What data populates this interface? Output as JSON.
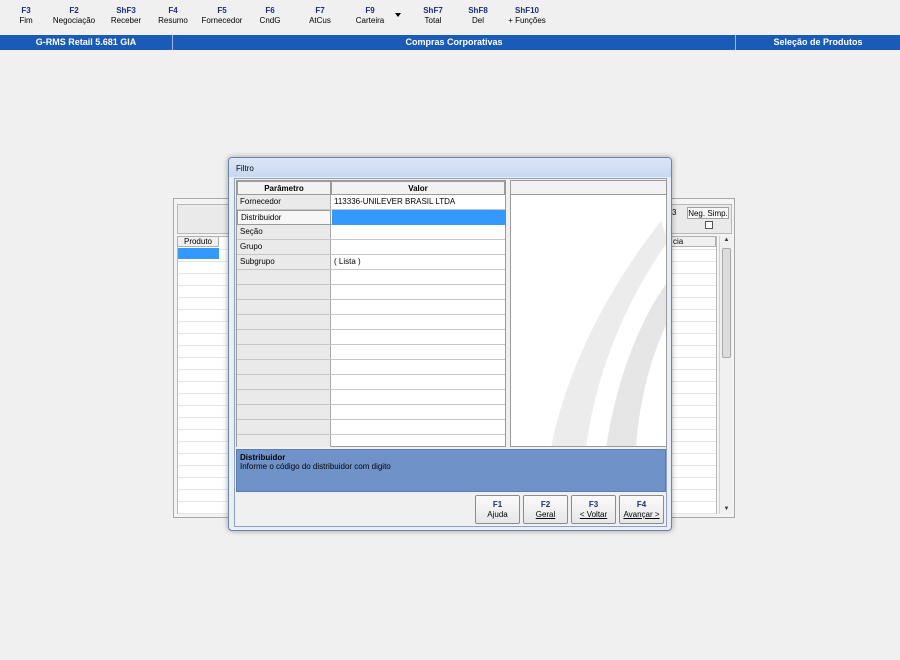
{
  "toolbar": {
    "keys": [
      {
        "key": "F3",
        "label": "Fim"
      },
      {
        "key": "F2",
        "label": "Negociação"
      },
      {
        "key": "ShF3",
        "label": "Receber"
      },
      {
        "key": "F4",
        "label": "Resumo"
      },
      {
        "key": "F5",
        "label": "Fornecedor"
      },
      {
        "key": "F6",
        "label": "CndG"
      },
      {
        "key": "F7",
        "label": "AtCus"
      },
      {
        "key": "F9",
        "label": "Carteira"
      },
      {
        "key": "ShF7",
        "label": "Total"
      },
      {
        "key": "ShF8",
        "label": "Del"
      },
      {
        "key": "ShF10",
        "label": "+ Funções"
      }
    ]
  },
  "titlebar": {
    "app": "G-RMS Retail 5.681 GIA",
    "module": "Compras Corporativas",
    "screen": "Seleção de Produtos"
  },
  "background_window": {
    "col_produto": "Produto",
    "col_cia": "cia",
    "neg_simp": "Neg. Simp.",
    "num": "3",
    "neg_simp_checked": false
  },
  "dialog": {
    "title": "Filtro",
    "headers": {
      "param": "Parâmetro",
      "value": "Valor"
    },
    "params": [
      {
        "name": "Fornecedor",
        "value": "113336-UNILEVER BRASIL LTDA"
      },
      {
        "name": "Distribuidor",
        "value": ""
      },
      {
        "name": "Seção",
        "value": ""
      },
      {
        "name": "Grupo",
        "value": ""
      },
      {
        "name": "Subgrupo",
        "value": "( Lista )"
      }
    ],
    "help_title": "Distribuidor",
    "help_text": "Informe o código do distribuidor com digito",
    "buttons": [
      {
        "key": "F1",
        "label": "Ajuda"
      },
      {
        "key": "F2",
        "label": "Geral"
      },
      {
        "key": "F3",
        "label": "< Voltar"
      },
      {
        "key": "F4",
        "label": "Avançar >"
      }
    ]
  },
  "colors": {
    "titlebar": "#1a5bb8",
    "selection": "#3399ff",
    "help_panel": "#6f93c9",
    "fkey_text": "#1c2d7a"
  }
}
